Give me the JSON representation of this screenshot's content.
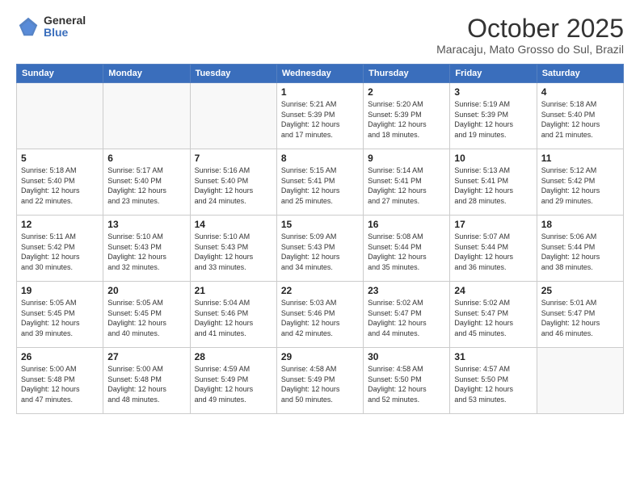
{
  "header": {
    "logo_general": "General",
    "logo_blue": "Blue",
    "month": "October 2025",
    "location": "Maracaju, Mato Grosso do Sul, Brazil"
  },
  "weekdays": [
    "Sunday",
    "Monday",
    "Tuesday",
    "Wednesday",
    "Thursday",
    "Friday",
    "Saturday"
  ],
  "weeks": [
    [
      {
        "day": "",
        "info": ""
      },
      {
        "day": "",
        "info": ""
      },
      {
        "day": "",
        "info": ""
      },
      {
        "day": "1",
        "info": "Sunrise: 5:21 AM\nSunset: 5:39 PM\nDaylight: 12 hours\nand 17 minutes."
      },
      {
        "day": "2",
        "info": "Sunrise: 5:20 AM\nSunset: 5:39 PM\nDaylight: 12 hours\nand 18 minutes."
      },
      {
        "day": "3",
        "info": "Sunrise: 5:19 AM\nSunset: 5:39 PM\nDaylight: 12 hours\nand 19 minutes."
      },
      {
        "day": "4",
        "info": "Sunrise: 5:18 AM\nSunset: 5:40 PM\nDaylight: 12 hours\nand 21 minutes."
      }
    ],
    [
      {
        "day": "5",
        "info": "Sunrise: 5:18 AM\nSunset: 5:40 PM\nDaylight: 12 hours\nand 22 minutes."
      },
      {
        "day": "6",
        "info": "Sunrise: 5:17 AM\nSunset: 5:40 PM\nDaylight: 12 hours\nand 23 minutes."
      },
      {
        "day": "7",
        "info": "Sunrise: 5:16 AM\nSunset: 5:40 PM\nDaylight: 12 hours\nand 24 minutes."
      },
      {
        "day": "8",
        "info": "Sunrise: 5:15 AM\nSunset: 5:41 PM\nDaylight: 12 hours\nand 25 minutes."
      },
      {
        "day": "9",
        "info": "Sunrise: 5:14 AM\nSunset: 5:41 PM\nDaylight: 12 hours\nand 27 minutes."
      },
      {
        "day": "10",
        "info": "Sunrise: 5:13 AM\nSunset: 5:41 PM\nDaylight: 12 hours\nand 28 minutes."
      },
      {
        "day": "11",
        "info": "Sunrise: 5:12 AM\nSunset: 5:42 PM\nDaylight: 12 hours\nand 29 minutes."
      }
    ],
    [
      {
        "day": "12",
        "info": "Sunrise: 5:11 AM\nSunset: 5:42 PM\nDaylight: 12 hours\nand 30 minutes."
      },
      {
        "day": "13",
        "info": "Sunrise: 5:10 AM\nSunset: 5:43 PM\nDaylight: 12 hours\nand 32 minutes."
      },
      {
        "day": "14",
        "info": "Sunrise: 5:10 AM\nSunset: 5:43 PM\nDaylight: 12 hours\nand 33 minutes."
      },
      {
        "day": "15",
        "info": "Sunrise: 5:09 AM\nSunset: 5:43 PM\nDaylight: 12 hours\nand 34 minutes."
      },
      {
        "day": "16",
        "info": "Sunrise: 5:08 AM\nSunset: 5:44 PM\nDaylight: 12 hours\nand 35 minutes."
      },
      {
        "day": "17",
        "info": "Sunrise: 5:07 AM\nSunset: 5:44 PM\nDaylight: 12 hours\nand 36 minutes."
      },
      {
        "day": "18",
        "info": "Sunrise: 5:06 AM\nSunset: 5:44 PM\nDaylight: 12 hours\nand 38 minutes."
      }
    ],
    [
      {
        "day": "19",
        "info": "Sunrise: 5:05 AM\nSunset: 5:45 PM\nDaylight: 12 hours\nand 39 minutes."
      },
      {
        "day": "20",
        "info": "Sunrise: 5:05 AM\nSunset: 5:45 PM\nDaylight: 12 hours\nand 40 minutes."
      },
      {
        "day": "21",
        "info": "Sunrise: 5:04 AM\nSunset: 5:46 PM\nDaylight: 12 hours\nand 41 minutes."
      },
      {
        "day": "22",
        "info": "Sunrise: 5:03 AM\nSunset: 5:46 PM\nDaylight: 12 hours\nand 42 minutes."
      },
      {
        "day": "23",
        "info": "Sunrise: 5:02 AM\nSunset: 5:47 PM\nDaylight: 12 hours\nand 44 minutes."
      },
      {
        "day": "24",
        "info": "Sunrise: 5:02 AM\nSunset: 5:47 PM\nDaylight: 12 hours\nand 45 minutes."
      },
      {
        "day": "25",
        "info": "Sunrise: 5:01 AM\nSunset: 5:47 PM\nDaylight: 12 hours\nand 46 minutes."
      }
    ],
    [
      {
        "day": "26",
        "info": "Sunrise: 5:00 AM\nSunset: 5:48 PM\nDaylight: 12 hours\nand 47 minutes."
      },
      {
        "day": "27",
        "info": "Sunrise: 5:00 AM\nSunset: 5:48 PM\nDaylight: 12 hours\nand 48 minutes."
      },
      {
        "day": "28",
        "info": "Sunrise: 4:59 AM\nSunset: 5:49 PM\nDaylight: 12 hours\nand 49 minutes."
      },
      {
        "day": "29",
        "info": "Sunrise: 4:58 AM\nSunset: 5:49 PM\nDaylight: 12 hours\nand 50 minutes."
      },
      {
        "day": "30",
        "info": "Sunrise: 4:58 AM\nSunset: 5:50 PM\nDaylight: 12 hours\nand 52 minutes."
      },
      {
        "day": "31",
        "info": "Sunrise: 4:57 AM\nSunset: 5:50 PM\nDaylight: 12 hours\nand 53 minutes."
      },
      {
        "day": "",
        "info": ""
      }
    ]
  ]
}
